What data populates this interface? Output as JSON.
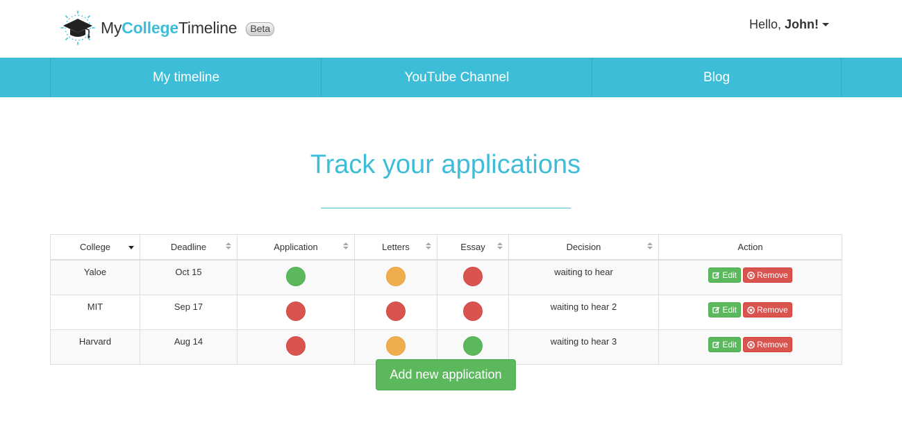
{
  "brand": {
    "name_part1": "My",
    "name_part2": "College",
    "name_part3": "Timeline",
    "badge": "Beta",
    "accent_color": "#3dbdd8"
  },
  "user_menu": {
    "greeting": "Hello,",
    "name": "John!"
  },
  "nav": {
    "items": [
      {
        "label": "My timeline"
      },
      {
        "label": "YouTube Channel"
      },
      {
        "label": "Blog"
      }
    ]
  },
  "page": {
    "title": "Track your applications"
  },
  "table": {
    "headers": [
      "College",
      "Deadline",
      "Application",
      "Letters",
      "Essay",
      "Decision",
      "Action"
    ],
    "sorted_column": "College",
    "rows": [
      {
        "college": "Yaloe",
        "deadline": "Oct 15",
        "application": "green",
        "letters": "orange",
        "essay": "red",
        "decision": "waiting to hear"
      },
      {
        "college": "MIT",
        "deadline": "Sep 17",
        "application": "red",
        "letters": "red",
        "essay": "red",
        "decision": "waiting to hear 2"
      },
      {
        "college": "Harvard",
        "deadline": "Aug 14",
        "application": "red",
        "letters": "orange",
        "essay": "green",
        "decision": "waiting to hear 3"
      }
    ],
    "edit_label": "Edit",
    "remove_label": "Remove"
  },
  "actions": {
    "add_label": "Add new application"
  },
  "colors": {
    "green": "#5cb85c",
    "orange": "#f0ad4e",
    "red": "#d9534f"
  }
}
